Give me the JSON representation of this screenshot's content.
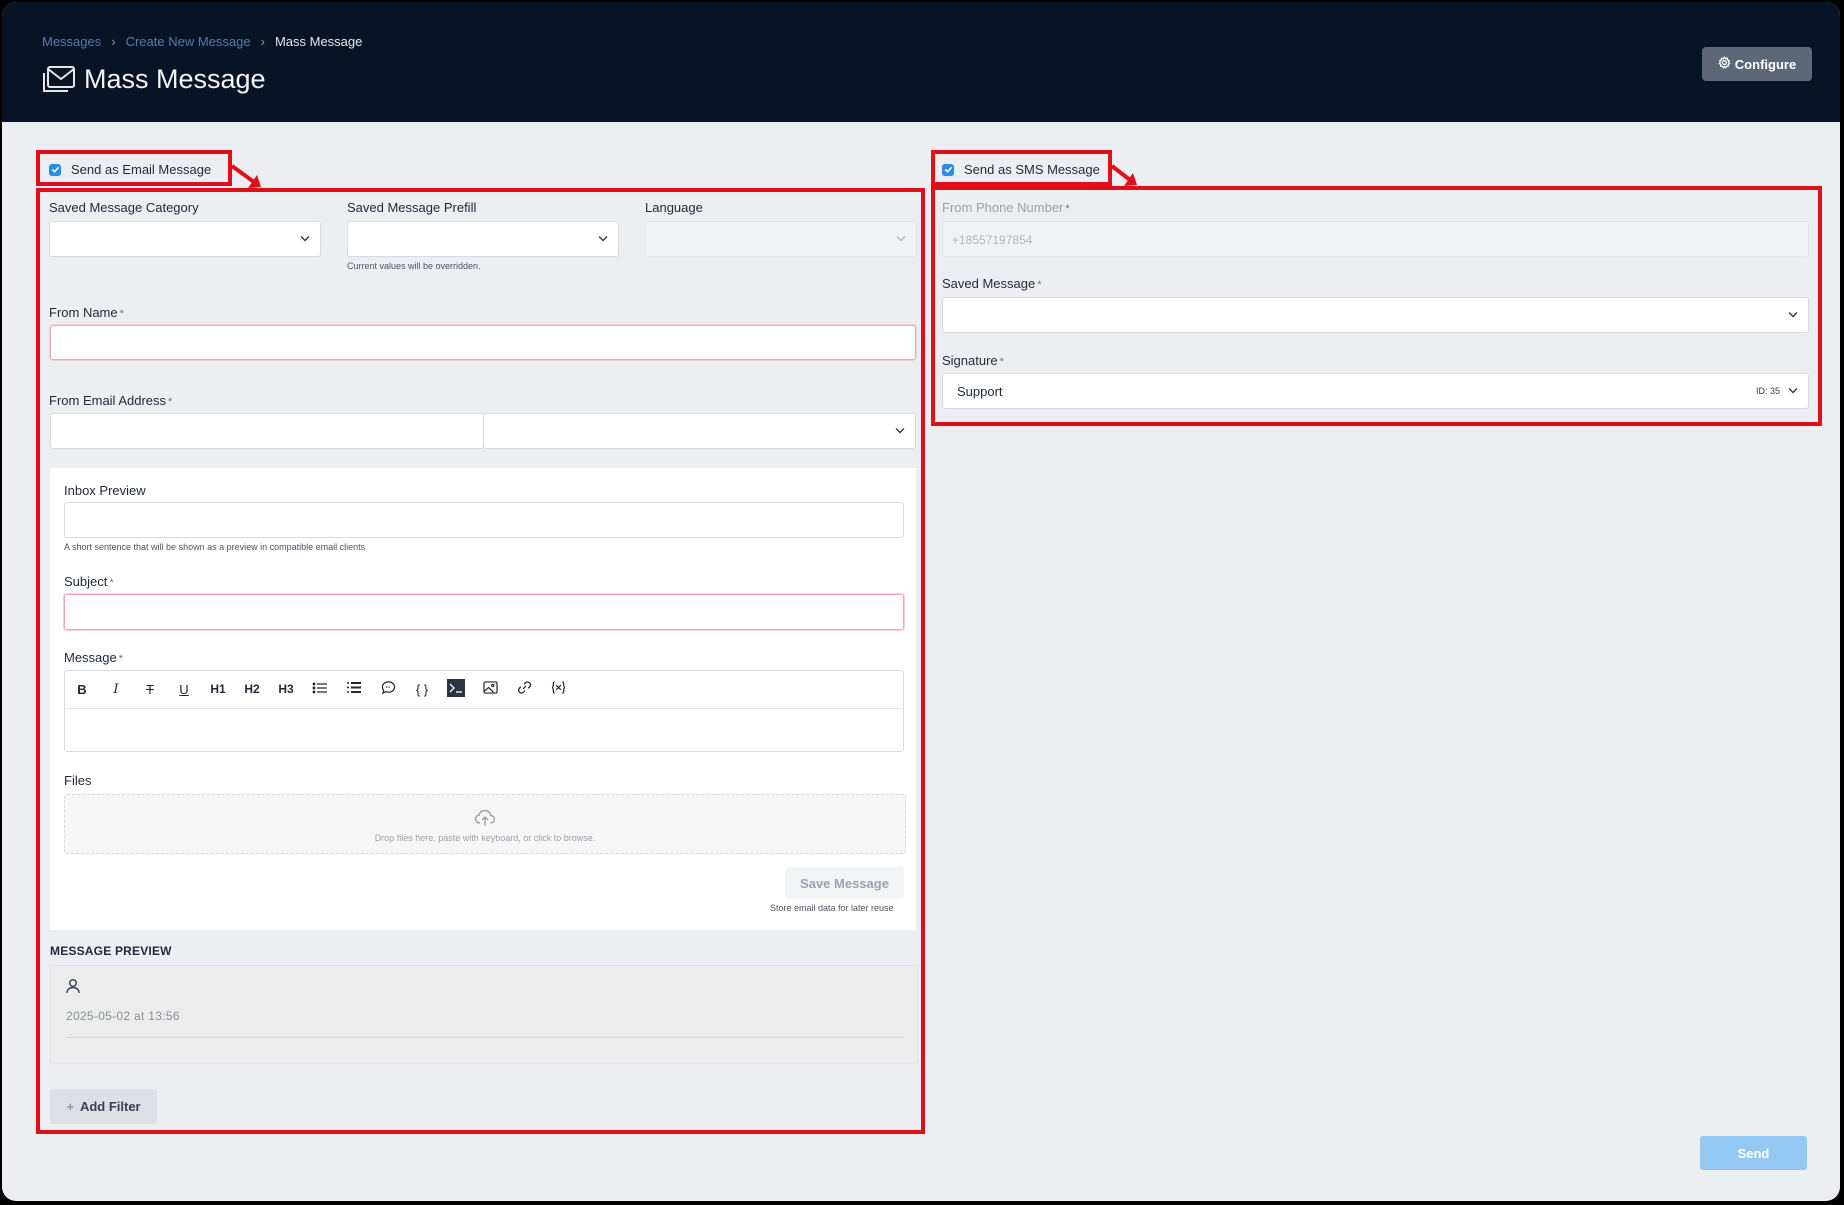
{
  "header": {
    "breadcrumb": [
      "Messages",
      "Create New Message",
      "Mass Message"
    ],
    "breadcrumb_separator": "›",
    "title": "Mass Message",
    "configure_label": "Configure"
  },
  "email": {
    "checkbox_label": "Send as Email Message",
    "checked": true,
    "saved_category_label": "Saved Message Category",
    "saved_prefill_label": "Saved Message Prefill",
    "prefill_help": "Current values will be overridden.",
    "language_label": "Language",
    "from_name_label": "From Name",
    "from_email_label": "From Email Address",
    "inbox_preview_label": "Inbox Preview",
    "inbox_preview_help": "A short sentence that will be shown as a preview in compatible email clients",
    "subject_label": "Subject",
    "message_label": "Message",
    "toolbar": {
      "bold": "B",
      "italic": "I",
      "strike": "T",
      "underline": "U",
      "h1": "H1",
      "h2": "H2",
      "h3": "H3",
      "code": "{ }"
    },
    "files_label": "Files",
    "dropzone_text": "Drop files here, paste with keyboard, or click to browse.",
    "save_message_label": "Save Message",
    "save_message_help": "Store email data for later reuse",
    "preview_title": "MESSAGE PREVIEW",
    "preview_date": "2025-05-02 at 13:56",
    "add_filter_label": "Add Filter",
    "add_filter_plus": "+"
  },
  "sms": {
    "checkbox_label": "Send as SMS Message",
    "checked": true,
    "from_phone_label": "From Phone Number",
    "from_phone_placeholder": "+18557197854",
    "saved_message_label": "Saved Message",
    "signature_label": "Signature",
    "signature_value": "Support",
    "signature_id": "ID: 35"
  },
  "required_mark": "*",
  "send_label": "Send",
  "colors": {
    "header_bg": "#061426",
    "annotation_red": "#e0101a",
    "checkbox_blue": "#2b8be6",
    "send_disabled": "#93c8f3"
  }
}
